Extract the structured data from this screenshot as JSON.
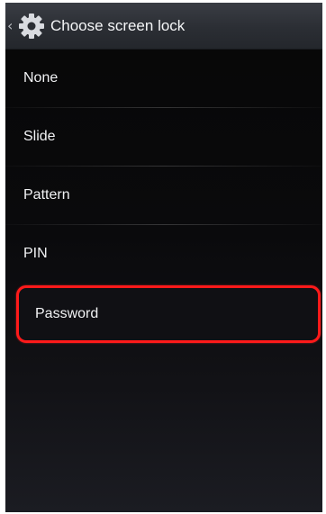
{
  "action_bar": {
    "title": "Choose screen lock",
    "icon": "settings-gear-icon",
    "back_glyph": "‹"
  },
  "options": [
    {
      "label": "None"
    },
    {
      "label": "Slide"
    },
    {
      "label": "Pattern"
    },
    {
      "label": "PIN"
    },
    {
      "label": "Password"
    }
  ],
  "highlighted_option": "Password",
  "colors": {
    "highlight_border": "#ff1a1a",
    "background": "#070707",
    "action_bar": "#2b2e34",
    "text": "#f1f2f4"
  }
}
